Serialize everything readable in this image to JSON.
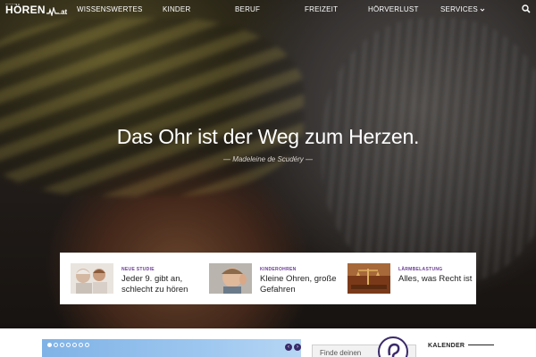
{
  "header": {
    "logo": {
      "pre": "────",
      "brand": "HÖREN",
      "tld": ".at"
    },
    "nav": [
      {
        "label": "WISSENSWERTES"
      },
      {
        "label": "KINDER"
      },
      {
        "label": "BERUF"
      },
      {
        "label": "FREIZEIT"
      },
      {
        "label": "HÖRVERLUST"
      },
      {
        "label": "SERVICES"
      }
    ],
    "search_icon": "search-icon"
  },
  "hero": {
    "quote": "Das Ohr ist der Weg zum Herzen.",
    "author": "— Madeleine de Scudéry —"
  },
  "teasers": [
    {
      "category": "NEUE STUDIE",
      "title": "Jeder 9. gibt an, schlecht zu hören"
    },
    {
      "category": "KINDEROHREN",
      "title": "Kleine Ohren, große Gefahren"
    },
    {
      "category": "LÄRMBELASTUNG",
      "title": "Alles, was Recht ist"
    }
  ],
  "bottom": {
    "finder_text": "Finde deinen",
    "calendar_heading": "KALENDER"
  },
  "colors": {
    "accent": "#6a3a96",
    "dark_purple": "#3a2a6a"
  }
}
